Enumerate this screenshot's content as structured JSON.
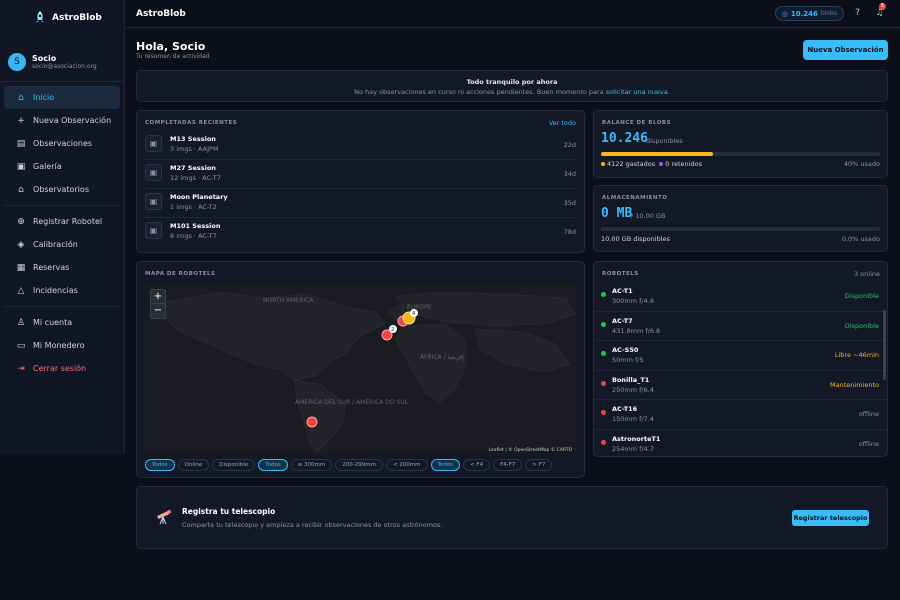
{
  "app": {
    "name": "AstroBlob",
    "topbar_title": "AstroBlob"
  },
  "user": {
    "initial": "S",
    "name": "Socio",
    "email": "socio@asociacion.org"
  },
  "nav": {
    "items": [
      {
        "label": "Inicio",
        "icon": "home-icon",
        "active": true
      },
      {
        "label": "Nueva Observación",
        "icon": "plus-icon"
      },
      {
        "label": "Observaciones",
        "icon": "clipboard-icon"
      },
      {
        "label": "Galería",
        "icon": "image-icon"
      },
      {
        "label": "Observatorios",
        "icon": "building-icon"
      },
      {
        "label": "Registrar Robotel",
        "icon": "plus-circle-icon"
      },
      {
        "label": "Calibración",
        "icon": "layers-icon"
      },
      {
        "label": "Reservas",
        "icon": "calendar-icon"
      },
      {
        "label": "Incidencias",
        "icon": "warning-icon"
      },
      {
        "label": "Mi cuenta",
        "icon": "user-icon"
      },
      {
        "label": "Mi Monedero",
        "icon": "wallet-icon"
      },
      {
        "label": "Cerrar sesión",
        "icon": "logout-icon"
      }
    ]
  },
  "topbar": {
    "blobs_value": "10.246",
    "blobs_unit": "blobs",
    "notif_count": "5"
  },
  "header": {
    "title": "Hola, Socio",
    "subtitle": "Tu resumen de actividad",
    "new_obs": "Nueva Observación"
  },
  "notice": {
    "title": "Todo tranquilo por ahora",
    "text": "No hay observaciones en curso ni acciones pendientes. Buen momento para",
    "link": "solicitar una nueva",
    "end": "."
  },
  "recent": {
    "title": "COMPLETADAS RECIENTES",
    "link": "Ver todo",
    "items": [
      {
        "name": "M13 Session",
        "meta": "3 imgs · AAJPM",
        "age": "22d"
      },
      {
        "name": "M27 Session",
        "meta": "12 imgs · AC-T7",
        "age": "34d"
      },
      {
        "name": "Moon Planetary",
        "meta": "1 imgs · AC-T2",
        "age": "35d"
      },
      {
        "name": "M101 Session",
        "meta": "8 imgs · AC-T7",
        "age": "78d"
      }
    ]
  },
  "balance": {
    "title": "BALANCE DE BLOBS",
    "value": "10.246",
    "unit": "disponibles",
    "used_fraction": 0.4,
    "spent": "4122 gastados",
    "retained": "0 retenidos",
    "pct": "40% usado",
    "spent_color": "#f5b81a",
    "retained_color": "#a855f7"
  },
  "storage": {
    "title": "ALMACENAMIENTO",
    "value": "0 MB",
    "total": "/ 10.00 GB",
    "available": "10.00 GB disponibles",
    "pct": "0.0% usado"
  },
  "map": {
    "title": "MAPA DE ROBOTELS",
    "zoom_in": "+",
    "zoom_out": "−",
    "labels": {
      "na": "NORTH AMERICA",
      "eu": "EUROPE",
      "af": "ÁFRICA / إفريقيا",
      "sa": "AMÉRICA DEL SUR / AMÉRICA DO SUL"
    },
    "cluster_a": "2",
    "cluster_b": "4",
    "attribution": "Leaflet | © OpenStreetMap © CARTO",
    "chips": [
      {
        "label": "Todos",
        "on": true
      },
      {
        "label": "Online"
      },
      {
        "label": "Disponible"
      },
      {
        "label": "Todos",
        "on": true
      },
      {
        "label": "≥ 300mm"
      },
      {
        "label": "200-299mm"
      },
      {
        "label": "< 200mm"
      },
      {
        "label": "Todos",
        "on": true
      },
      {
        "label": "< F4"
      },
      {
        "label": "F4-F7"
      },
      {
        "label": "> F7"
      }
    ]
  },
  "robotels": {
    "title": "ROBOTELS",
    "online": "3 online",
    "items": [
      {
        "name": "AC-T1",
        "meta": "300mm f/4.8",
        "status": "Disponible",
        "dot": "#22c55e",
        "color": "#22c55e"
      },
      {
        "name": "AC-T7",
        "meta": "431.8mm f/6.8",
        "status": "Disponible",
        "dot": "#22c55e",
        "color": "#22c55e"
      },
      {
        "name": "AC-S50",
        "meta": "50mm f/5",
        "status": "Libre ~46min",
        "dot": "#22c55e",
        "color": "#f5b81a"
      },
      {
        "name": "Bonilla_T1",
        "meta": "250mm f/6.4",
        "status": "Mantenimiento",
        "dot": "#ef4444",
        "color": "#f5b81a"
      },
      {
        "name": "AC-T16",
        "meta": "150mm f/7.4",
        "status": "offline",
        "dot": "#ef4444",
        "color": "#8892a6"
      },
      {
        "name": "AstronorteT1",
        "meta": "254mm f/4.7",
        "status": "offline",
        "dot": "#ef4444",
        "color": "#8892a6"
      }
    ]
  },
  "register": {
    "title": "Registra tu telescopio",
    "desc": "Comparte tu telescopio y empieza a recibir observaciones de otros astrónomos.",
    "button": "Registrar telescopio"
  }
}
